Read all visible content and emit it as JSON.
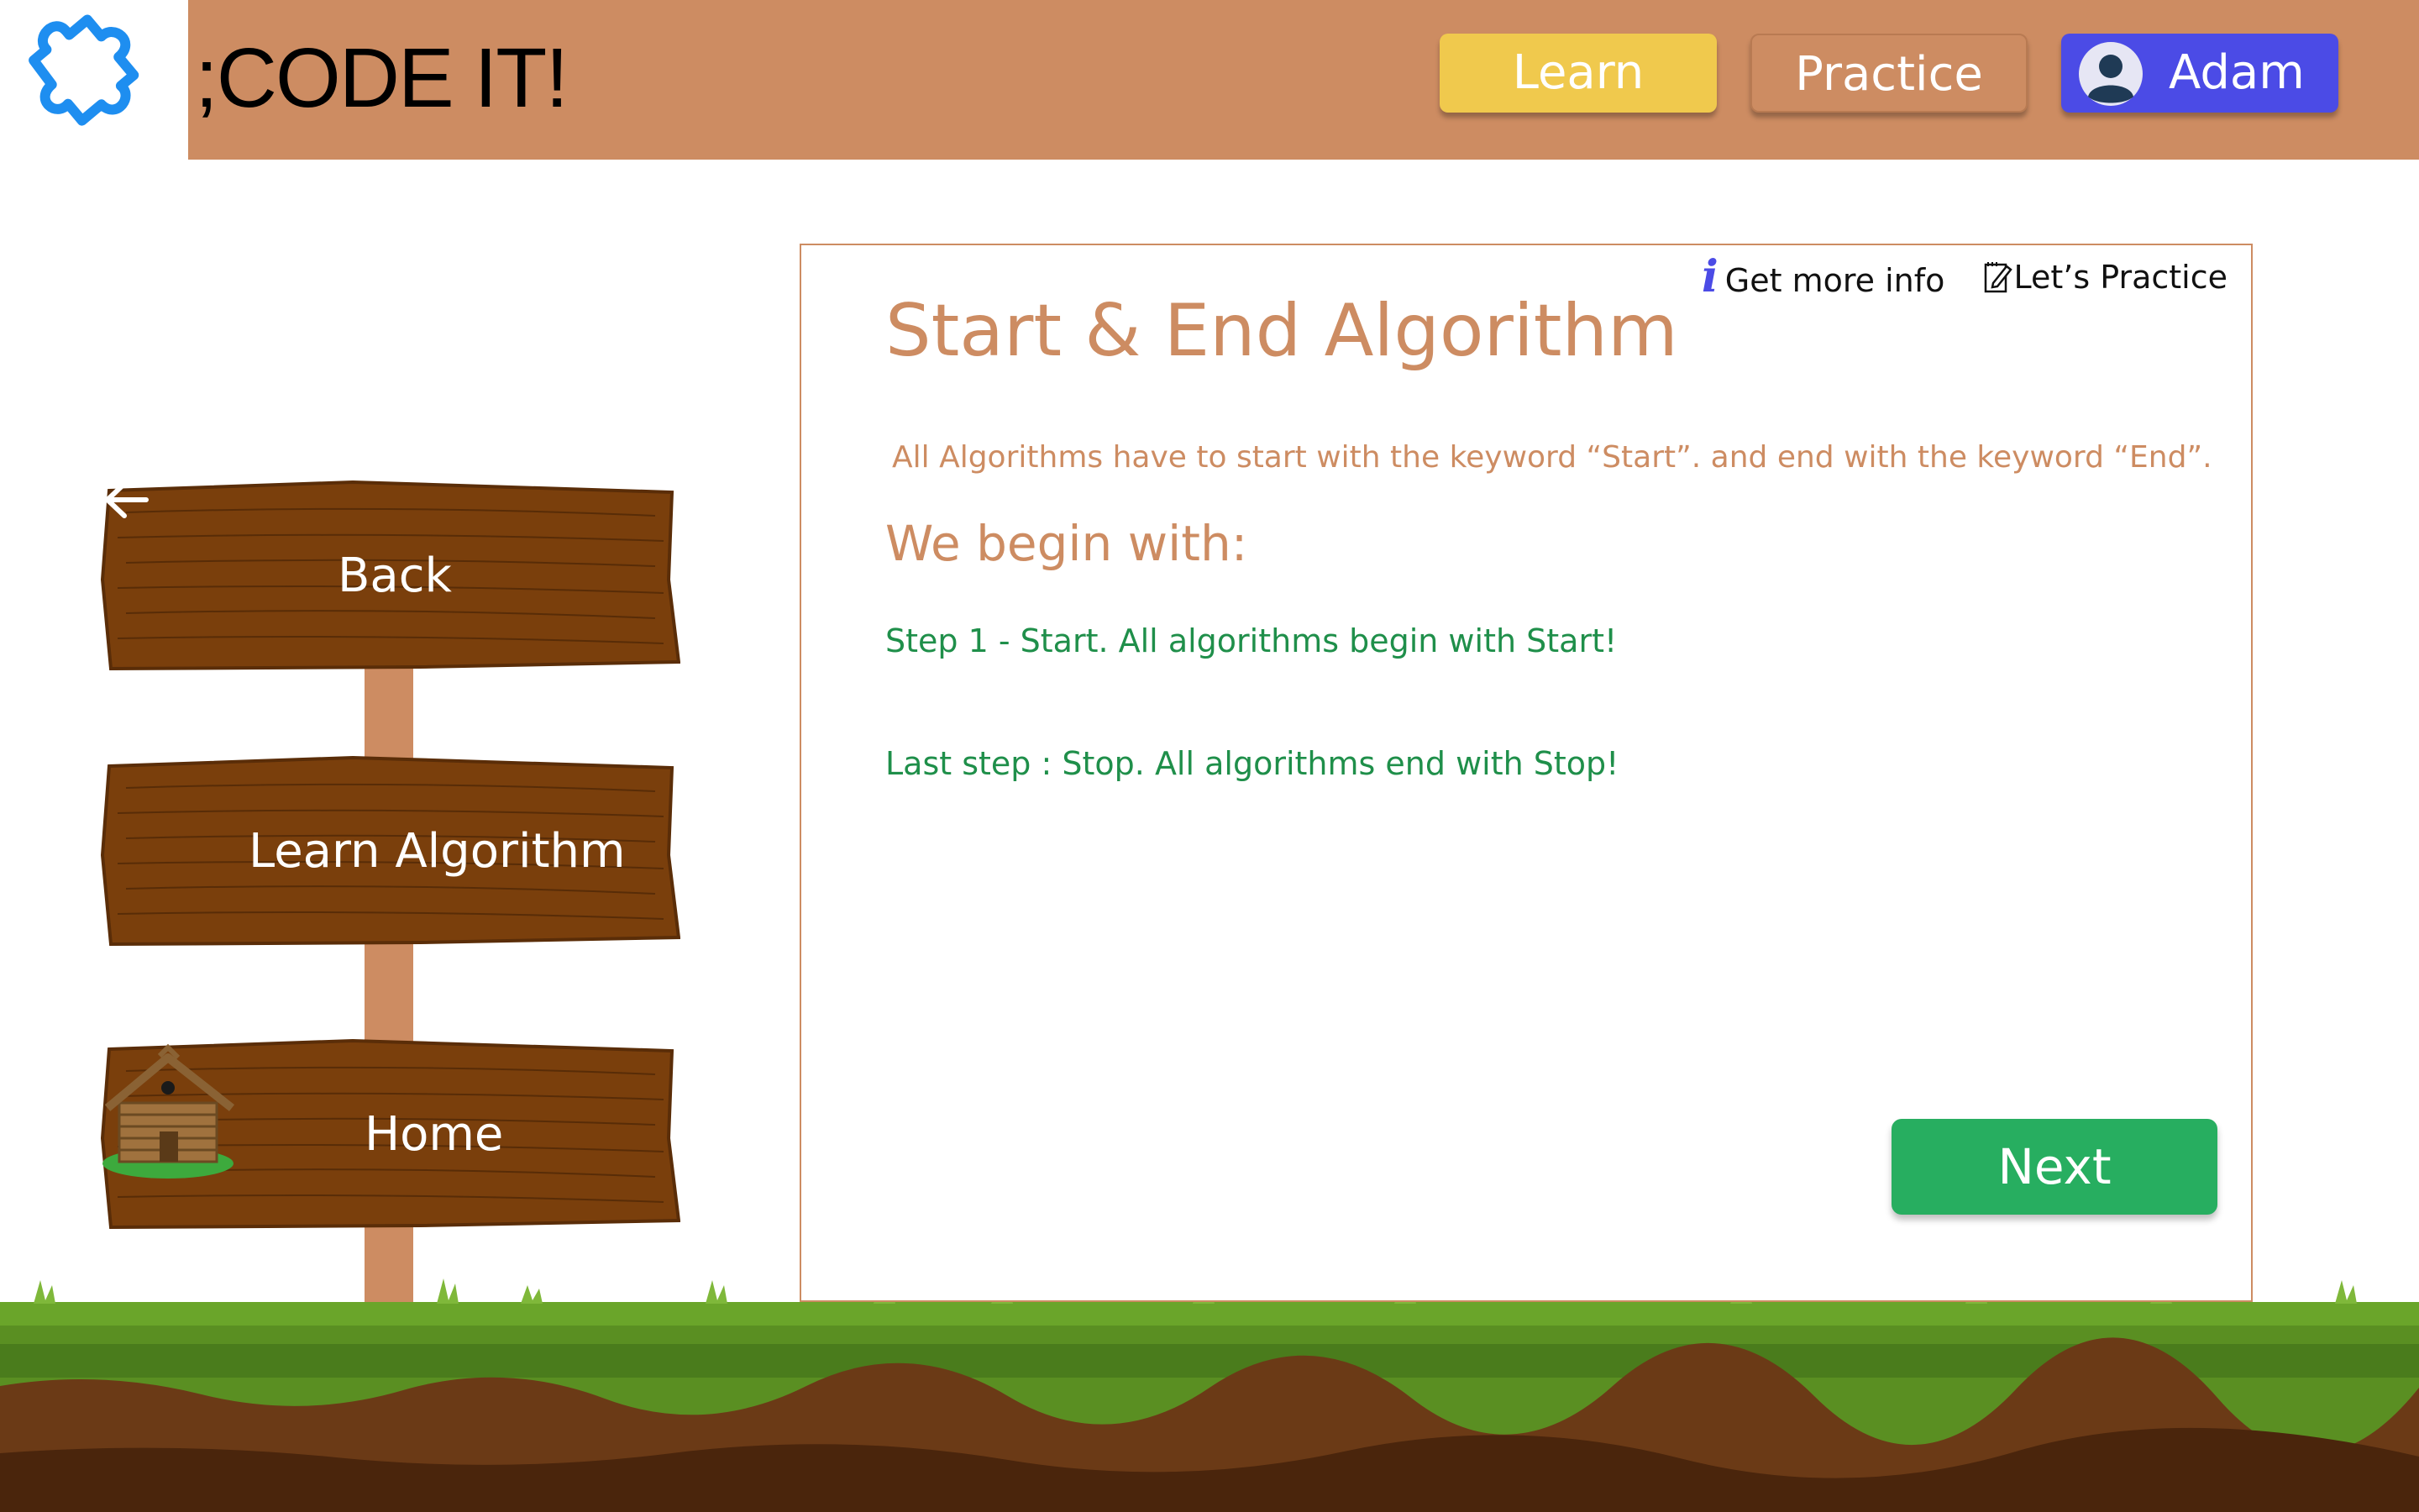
{
  "app": {
    "title": ";CODE IT!",
    "logo_icon": "puzzle-piece-icon"
  },
  "nav": {
    "learn_label": "Learn",
    "practice_label": "Practice",
    "user_name": "Adam",
    "user_icon": "user-avatar-icon",
    "active": "Learn"
  },
  "signpost": {
    "back_label": "Back",
    "learn_label": "Learn Algorithm",
    "home_label": "Home",
    "back_icon": "arrow-left-icon",
    "home_icon": "log-cabin-icon"
  },
  "content": {
    "info_link": "Get more info",
    "practice_link": "Let’s Practice",
    "title": "Start & End Algorithm",
    "description": "All Algorithms have to start with the keyword “Start”. and end with the keyword “End”.",
    "subheading": "We begin with:",
    "steps": [
      "Step 1 - Start. All algorithms begin with Start!",
      "Last step : Stop. All algorithms end with Stop!"
    ],
    "next_label": "Next"
  },
  "colors": {
    "header": "#cd8c62",
    "learn_button": "#f0c94d",
    "user_button": "#4b4be6",
    "next_button": "#27ae60",
    "step_text": "#1f8f4a",
    "wood": "#7a3f0c",
    "grass": "#5a9a24"
  }
}
